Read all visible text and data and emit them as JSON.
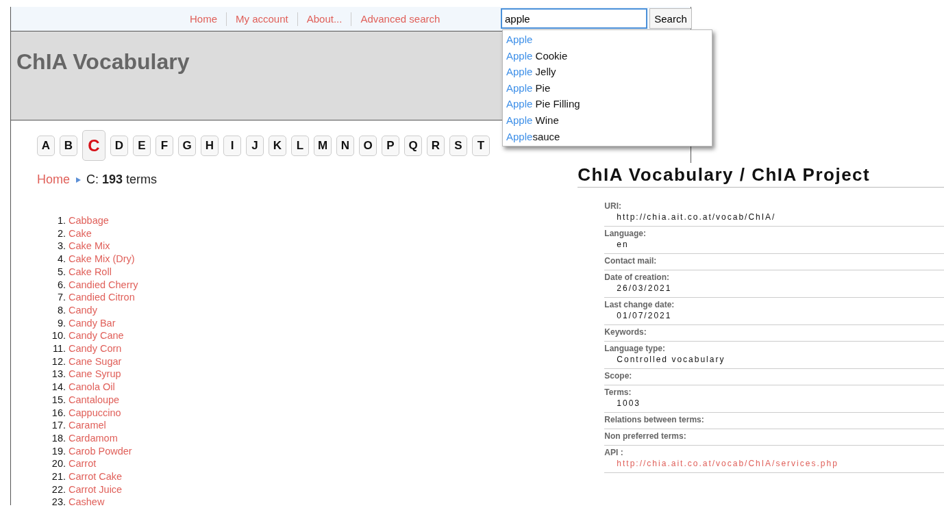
{
  "nav": {
    "links": [
      "Home",
      "My account",
      "About...",
      "Advanced search"
    ],
    "search": {
      "value": "apple",
      "button": "Search"
    }
  },
  "suggestions": [
    {
      "match": "Apple"
    },
    {
      "match": "Apple",
      "rest": " Cookie"
    },
    {
      "match": "Apple",
      "rest": " Jelly"
    },
    {
      "match": "Apple",
      "rest": " Pie"
    },
    {
      "match": "Apple",
      "rest": " Pie Filling"
    },
    {
      "match": "Apple",
      "rest": " Wine"
    },
    {
      "match": "Apple",
      "rest": "sauce"
    }
  ],
  "header": {
    "title": "ChIA Vocabulary"
  },
  "letters": [
    {
      "label": "A",
      "selected": false
    },
    {
      "label": "B",
      "selected": false
    },
    {
      "label": "C",
      "selected": true
    },
    {
      "label": "D",
      "selected": false
    },
    {
      "label": "E",
      "selected": false
    },
    {
      "label": "F",
      "selected": false
    },
    {
      "label": "G",
      "selected": false
    },
    {
      "label": "H",
      "selected": false
    },
    {
      "label": "I",
      "selected": false
    },
    {
      "label": "J",
      "selected": false
    },
    {
      "label": "K",
      "selected": false
    },
    {
      "label": "L",
      "selected": false
    },
    {
      "label": "M",
      "selected": false
    },
    {
      "label": "N",
      "selected": false
    },
    {
      "label": "O",
      "selected": false
    },
    {
      "label": "P",
      "selected": false
    },
    {
      "label": "Q",
      "selected": false
    },
    {
      "label": "R",
      "selected": false
    },
    {
      "label": "S",
      "selected": false
    },
    {
      "label": "T",
      "selected": false
    }
  ],
  "breadcrumb": {
    "home": "Home",
    "current": "C: **193** terms"
  },
  "terms": [
    {
      "number": "1.",
      "name": "Cabbage"
    },
    {
      "number": "2.",
      "name": "Cake"
    },
    {
      "number": "3.",
      "name": "Cake Mix"
    },
    {
      "number": "4.",
      "name": "Cake Mix (Dry)"
    },
    {
      "number": "5.",
      "name": "Cake Roll"
    },
    {
      "number": "6.",
      "name": "Candied Cherry"
    },
    {
      "number": "7.",
      "name": "Candied Citron"
    },
    {
      "number": "8.",
      "name": "Candy"
    },
    {
      "number": "9.",
      "name": "Candy Bar"
    },
    {
      "number": "10.",
      "name": "Candy Cane"
    },
    {
      "number": "11.",
      "name": "Candy Corn"
    },
    {
      "number": "12.",
      "name": "Cane Sugar"
    },
    {
      "number": "13.",
      "name": "Cane Syrup"
    },
    {
      "number": "14.",
      "name": "Canola Oil"
    },
    {
      "number": "15.",
      "name": "Cantaloupe"
    },
    {
      "number": "16.",
      "name": "Cappuccino"
    },
    {
      "number": "17.",
      "name": "Caramel"
    },
    {
      "number": "18.",
      "name": "Cardamom"
    },
    {
      "number": "19.",
      "name": "Carob Powder"
    },
    {
      "number": "20.",
      "name": "Carrot"
    },
    {
      "number": "21.",
      "name": "Carrot Cake"
    },
    {
      "number": "22.",
      "name": "Carrot Juice"
    },
    {
      "number": "23.",
      "name": "Cashew"
    }
  ],
  "info": {
    "title": "ChIA Vocabulary / ChIA Project",
    "fields": [
      {
        "label": "URI:",
        "value": "http://chia.ait.co.at/vocab/ChIA/",
        "kind": "text"
      },
      {
        "label": "Language:",
        "value": "en",
        "kind": "text"
      },
      {
        "label": "Contact mail:",
        "kind": "empty"
      },
      {
        "label": "Date of creation:",
        "value": "26/03/2021",
        "kind": "text"
      },
      {
        "label": "Last change date:",
        "value": "01/07/2021",
        "kind": "text"
      },
      {
        "label": "Keywords:",
        "kind": "empty"
      },
      {
        "label": "Language type:",
        "value": "Controlled vocabulary",
        "kind": "text"
      },
      {
        "label": "Scope:",
        "kind": "empty"
      },
      {
        "label": "Terms:",
        "value": "1003",
        "kind": "text"
      },
      {
        "label": "Relations between terms:",
        "kind": "empty"
      },
      {
        "label": "Non preferred terms:",
        "kind": "empty"
      },
      {
        "label": "API :",
        "value": "http://chia.ait.co.at/vocab/ChIA/services.php",
        "kind": "link"
      }
    ]
  }
}
